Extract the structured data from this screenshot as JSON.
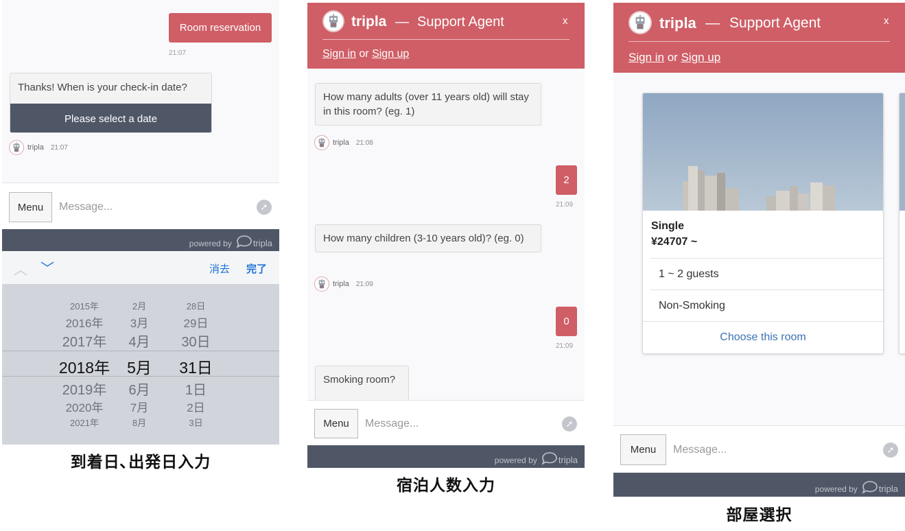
{
  "panel1": {
    "user_message": "Room reservation",
    "user_time": "21:07",
    "bot_message": "Thanks! When is your check-in date?",
    "quick_reply": "Please select a date",
    "bot_name": "tripla",
    "bot_time": "21:07",
    "composer": {
      "menu": "Menu",
      "placeholder": "Message..."
    },
    "footer": {
      "powered": "powered by",
      "brand": "tripla"
    },
    "picker": {
      "clear": "消去",
      "done": "完了",
      "years": [
        "2015年",
        "2016年",
        "2017年",
        "2018年",
        "2019年",
        "2020年",
        "2021年"
      ],
      "months": [
        "2月",
        "3月",
        "4月",
        "5月",
        "6月",
        "7月",
        "8月"
      ],
      "days": [
        "28日",
        "29日",
        "30日",
        "31日",
        "1日",
        "2日",
        "3日"
      ]
    },
    "caption": "到着日､出発日入力"
  },
  "panel2": {
    "header": {
      "brand": "tripla",
      "dash": "—",
      "agent": "Support Agent",
      "close": "x",
      "sign_in": "Sign in",
      "or": "or",
      "sign_up": "Sign up"
    },
    "messages": [
      {
        "bot": "How many adults (over 11 years old) will stay in this room? (eg. 1)",
        "name": "tripla",
        "time": "21:08"
      },
      {
        "user": "2",
        "time": "21:09"
      },
      {
        "bot": "How many children (3-10 years old)? (eg. 0)",
        "name": "tripla",
        "time": "21:09"
      },
      {
        "user": "0",
        "time": "21:09"
      },
      {
        "bot": "Smoking room?"
      }
    ],
    "composer": {
      "menu": "Menu",
      "placeholder": "Message..."
    },
    "footer": {
      "powered": "powered by",
      "brand": "tripla"
    },
    "caption": "宿泊人数入力"
  },
  "panel3": {
    "header": {
      "brand": "tripla",
      "dash": "—",
      "agent": "Support Agent",
      "close": "x",
      "sign_in": "Sign in",
      "or": "or",
      "sign_up": "Sign up"
    },
    "room": {
      "name": "Single",
      "price": "¥24707 ~",
      "guests": "1 ~ 2 guests",
      "smoking": "Non-Smoking",
      "choose": "Choose this room"
    },
    "composer": {
      "menu": "Menu",
      "placeholder": "Message..."
    },
    "footer": {
      "powered": "powered by",
      "brand": "tripla"
    },
    "caption": "部屋選択"
  },
  "colors": {
    "brand": "#cf5e66",
    "dark": "#4f5767",
    "link": "#1e73d8"
  }
}
